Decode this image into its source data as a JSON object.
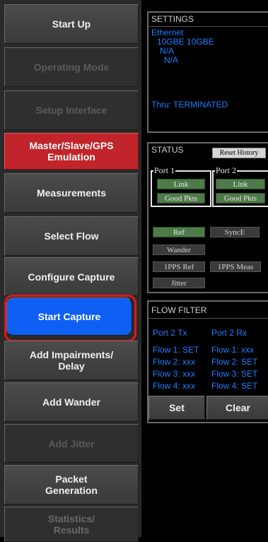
{
  "nav": {
    "start_up": "Start Up",
    "operating_mode": "Operating Mode",
    "setup_interface": "Setup Interface",
    "master_slave_line1": "Master/Slave/GPS",
    "master_slave_line2": "Emulation",
    "measurements": "Measurements",
    "select_flow": "Select Flow",
    "configure_capture": "Configure Capture",
    "start_capture": "Start Capture",
    "add_impairments_line1": "Add Impairments/",
    "add_impairments_line2": "Delay",
    "add_wander": "Add Wander",
    "add_jitter": "Add Jitter",
    "packet_generation_line1": "Packet",
    "packet_generation_line2": "Generation",
    "statistics_line1": "Statistics/",
    "statistics_line2": "Results"
  },
  "settings": {
    "title": "SETTINGS",
    "ethernet": "Ethernet",
    "speed": "10GBE  10GBE",
    "na1": "N/A",
    "na2": "N/A",
    "thru": "Thru: TERMINATED"
  },
  "status": {
    "title": "STATUS",
    "reset_history": "Reset History",
    "port1": "Port 1",
    "port2": "Port 2",
    "link": "Link",
    "good_pkts": "Good Pkts",
    "ref": "Ref",
    "synce": "SyncE",
    "wander": "Wander",
    "pps_ref": "1PPS Ref",
    "pps_meas": "1PPS Meas",
    "jitter": "Jitter"
  },
  "flow_filter": {
    "title": "FLOW FILTER",
    "tx_header": "Port 2 Tx",
    "rx_header": "Port 2 Rx",
    "rows": [
      {
        "tx": "Flow 1: SET",
        "rx": "Flow 1: xxx"
      },
      {
        "tx": "Flow 2: xxx",
        "rx": "Flow 2: SET"
      },
      {
        "tx": "Flow 3: xxx",
        "rx": "Flow 3: SET"
      },
      {
        "tx": "Flow 4: xxx",
        "rx": "Flow 4: SET"
      }
    ],
    "set_label": "Set",
    "clear_label": "Clear"
  },
  "colors": {
    "accent_red": "#c1242a",
    "accent_blue": "#0f5ff5",
    "status_green": "#4f7a4a",
    "info_blue": "#1e7fff"
  }
}
